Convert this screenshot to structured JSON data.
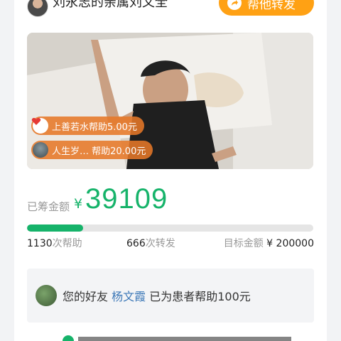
{
  "header": {
    "organizer": "刘永志的亲属刘文全",
    "share_button": "帮他转发",
    "avatar_icon": "user-avatar"
  },
  "photo": {
    "donations": [
      {
        "text": "上善若水帮助5.00元",
        "icon": "heart-icon"
      },
      {
        "text": "人生岁… 帮助20.00元",
        "icon": "user-avatar"
      }
    ]
  },
  "fundraising": {
    "raised_label": "已筹金额",
    "currency": "¥",
    "raised_amount": "39109",
    "progress_fraction": 0.1955
  },
  "stats": {
    "help_count": "1130",
    "help_unit": "次帮助",
    "share_count": "666",
    "share_unit": "次转发",
    "target_label": "目标金额",
    "target_currency": "¥",
    "target_amount": "200000"
  },
  "friend": {
    "prefix": "您的好友",
    "name": "杨文霞",
    "suffix": "已为患者帮助100元"
  },
  "colors": {
    "accent": "#16b36a",
    "share_button": "#ffa114",
    "donation_pill": "#e67828",
    "friend_name": "#3e79b8"
  }
}
